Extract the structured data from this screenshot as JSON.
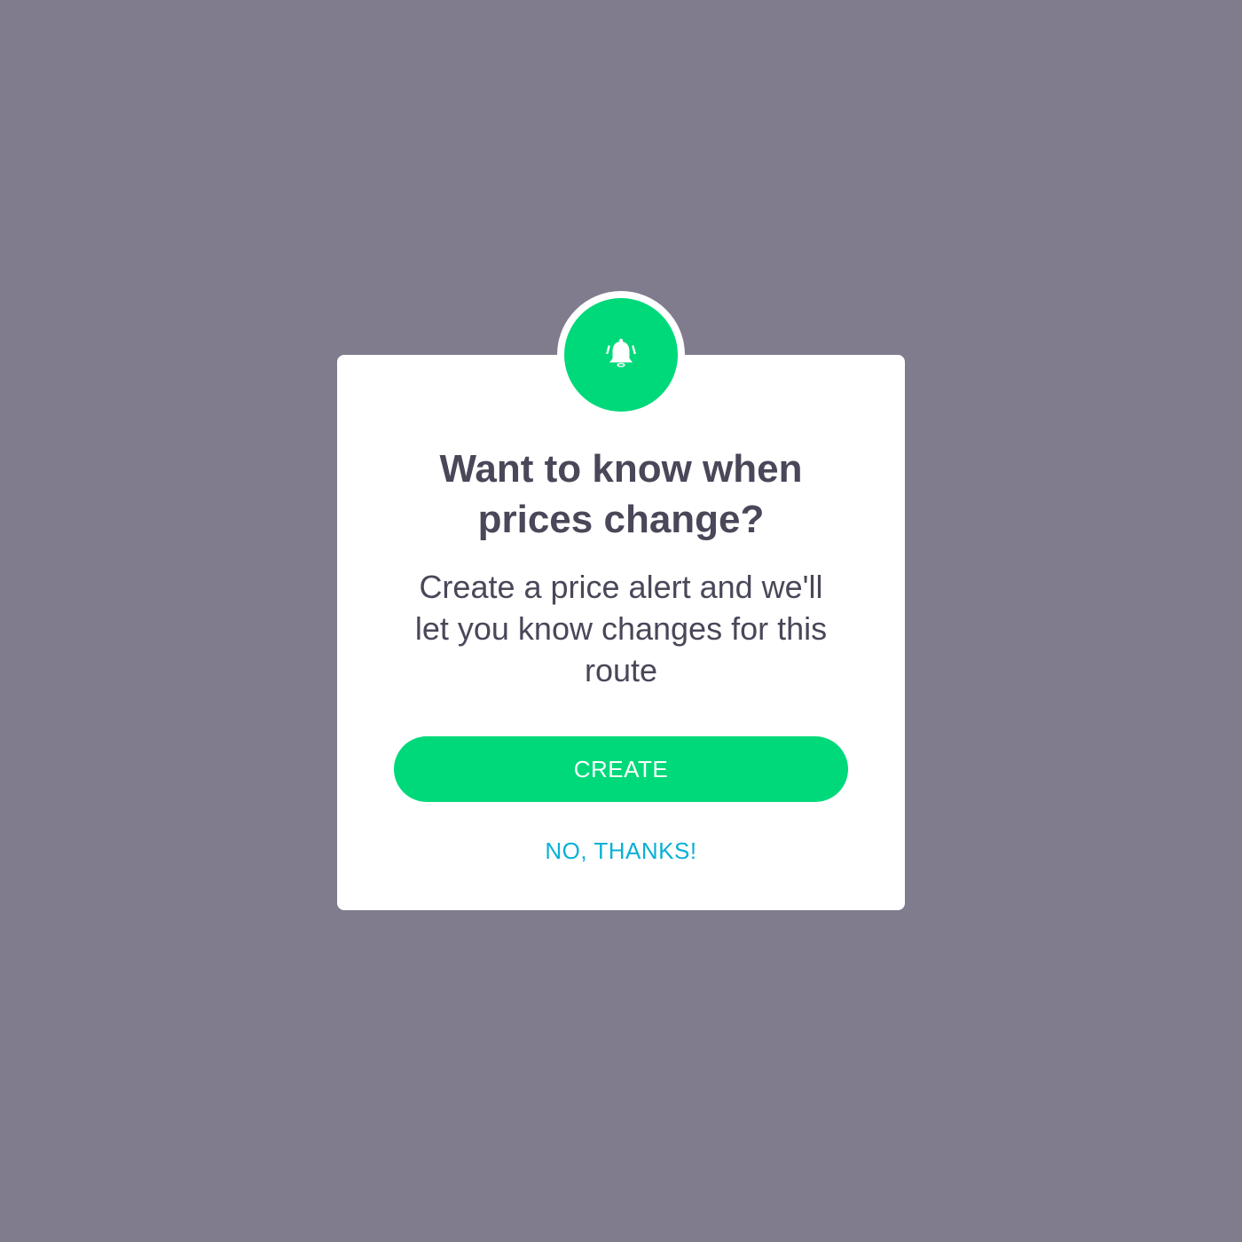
{
  "colors": {
    "backdrop": "#807c8e",
    "dialog_background": "#ffffff",
    "accent_green": "#00d97a",
    "text_dark": "#4a4759",
    "link_blue": "#0ab0d6"
  },
  "badge": {
    "icon": "bell-ringing-icon"
  },
  "dialog": {
    "title_lines": [
      "Want to know when",
      "prices change?"
    ],
    "message_lines": [
      "Create a price alert and we'll",
      "let you know changes for this",
      "route"
    ],
    "primary_button_label": "CREATE",
    "secondary_button_label": "NO, THANKS!"
  }
}
